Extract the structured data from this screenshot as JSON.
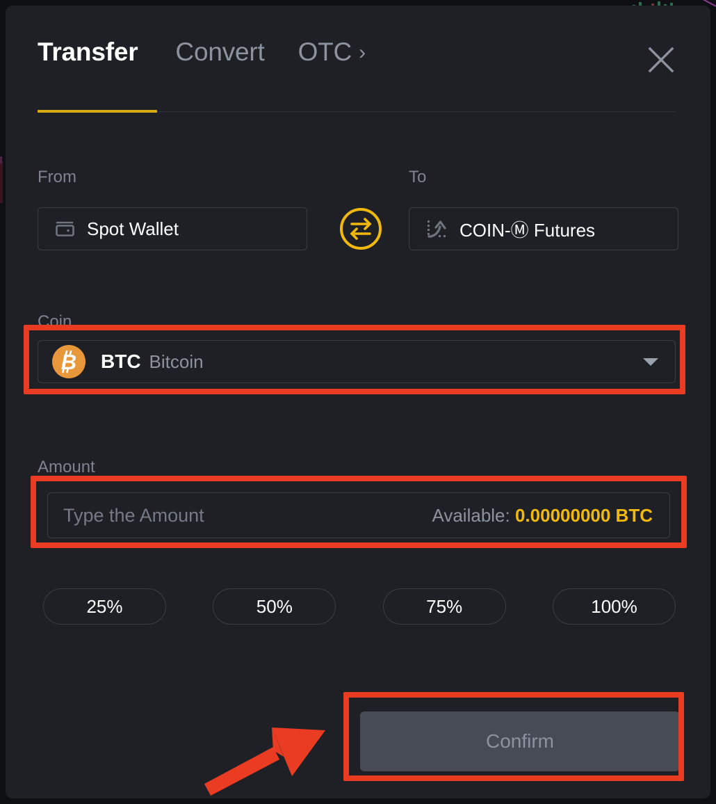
{
  "modal": {
    "tabs": [
      {
        "label": "Transfer",
        "active": true,
        "name": "tab-transfer"
      },
      {
        "label": "Convert",
        "active": false,
        "name": "tab-convert"
      },
      {
        "label": "OTC",
        "active": false,
        "name": "tab-otc"
      }
    ],
    "otc_chevron": "›",
    "close_icon": "close-icon",
    "accent_color": "#f0b90b",
    "panel_bg": "#1e2026"
  },
  "transfer": {
    "from": {
      "label": "From",
      "value": "Spot Wallet",
      "icon": "wallet-card-icon"
    },
    "to": {
      "label": "To",
      "value": "COIN-Ⓜ Futures",
      "icon": "futures-growth-arrow-icon"
    },
    "swap": {
      "icon": "swap-arrows-circle-icon",
      "color": "#f0b90b"
    },
    "coin": {
      "label": "Coin",
      "symbol": "BTC",
      "name": "Bitcoin",
      "glyph": "₿",
      "icon_color": "#e8973a",
      "caret_icon": "chevron-down-icon"
    },
    "amount": {
      "label": "Amount",
      "placeholder": "Type the Amount",
      "value": "",
      "available_label": "Available:",
      "available_value": "0.00000000 BTC",
      "available_color": "#f0b90b"
    },
    "percent_buttons": [
      "25%",
      "50%",
      "75%",
      "100%"
    ],
    "confirm": {
      "label": "Confirm",
      "disabled": true,
      "bg": "#474b56",
      "text_color": "#8d939e"
    }
  },
  "annotations": {
    "highlight_color": "#ea3c23",
    "boxes": [
      "coin-selector",
      "amount-input",
      "confirm-button"
    ],
    "arrow": "red-arrow-pointing-to-confirm"
  }
}
